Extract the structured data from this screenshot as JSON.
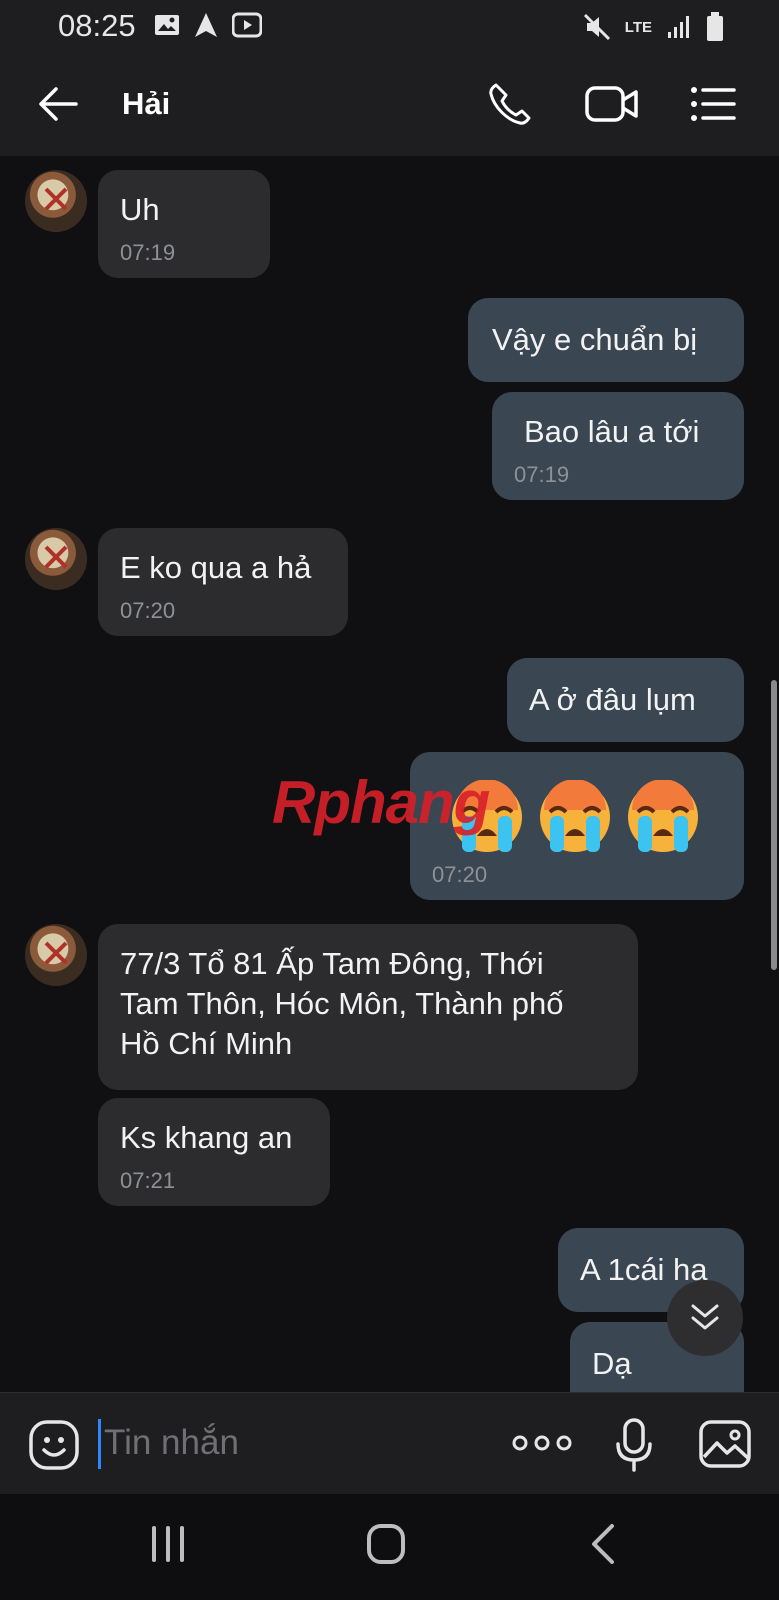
{
  "status_bar": {
    "time": "08:25",
    "network": "LTE"
  },
  "header": {
    "title": "Hải"
  },
  "messages": [
    {
      "dir": "in",
      "text": "Uh",
      "time": "07:19"
    },
    {
      "dir": "out",
      "text": "Vậy e chuẩn bị"
    },
    {
      "dir": "out",
      "text": "Bao lâu a tới",
      "time": "07:19"
    },
    {
      "dir": "in",
      "text": "E ko qua a hả",
      "time": "07:20"
    },
    {
      "dir": "out",
      "text": "A ở đâu lụm"
    },
    {
      "dir": "out",
      "text": "😭😭😭",
      "time": "07:20"
    },
    {
      "dir": "in",
      "text_lines": [
        "77/3 Tổ 81 Ấp Tam Đông, Thới",
        "Tam Thôn, Hóc Môn, Thành phố",
        "Hồ Chí Minh"
      ]
    },
    {
      "dir": "in",
      "text": "Ks khang an",
      "time": "07:21"
    },
    {
      "dir": "out",
      "text": "A 1cái ha"
    },
    {
      "dir": "out",
      "text": "Dạ"
    }
  ],
  "input": {
    "placeholder": "Tin nhắn"
  },
  "watermark": {
    "part1": "Rphang",
    "part2": ""
  },
  "icons": [
    "back-arrow-icon",
    "phone-icon",
    "video-camera-icon",
    "menu-list-icon",
    "emoji-icon",
    "more-icon",
    "microphone-icon",
    "gallery-icon",
    "chevron-double-down-icon"
  ]
}
